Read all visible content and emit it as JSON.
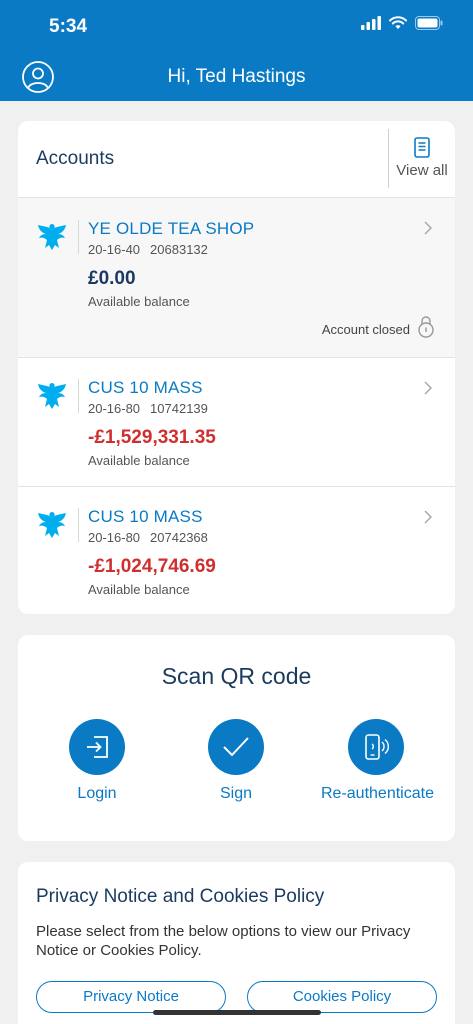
{
  "status_bar": {
    "time": "5:34"
  },
  "header": {
    "greeting": "Hi, Ted Hastings"
  },
  "accounts": {
    "title": "Accounts",
    "view_all_label": "View all",
    "items": [
      {
        "name": "YE OLDE TEA SHOP",
        "sort_code": "20-16-40",
        "account_number": "20683132",
        "balance": "£0.00",
        "balance_label": "Available balance",
        "status": "Account closed"
      },
      {
        "name": "CUS 10 MASS",
        "sort_code": "20-16-80",
        "account_number": "10742139",
        "balance": "-£1,529,331.35",
        "balance_label": "Available balance"
      },
      {
        "name": "CUS 10 MASS",
        "sort_code": "20-16-80",
        "account_number": "20742368",
        "balance": "-£1,024,746.69",
        "balance_label": "Available balance"
      }
    ]
  },
  "qr": {
    "title": "Scan QR code",
    "buttons": [
      {
        "label": "Login",
        "icon": "login-icon"
      },
      {
        "label": "Sign",
        "icon": "checkmark-icon"
      },
      {
        "label": "Re-authenticate",
        "icon": "phone-contactless-icon"
      }
    ]
  },
  "privacy": {
    "title": "Privacy Notice and Cookies Policy",
    "text": "Please select from the below options to view our Privacy Notice or Cookies Policy.",
    "privacy_button": "Privacy Notice",
    "cookies_button": "Cookies Policy"
  },
  "colors": {
    "brand": "#0a7ac5",
    "negative": "#cf2f2f",
    "heading": "#1a3a5f"
  }
}
